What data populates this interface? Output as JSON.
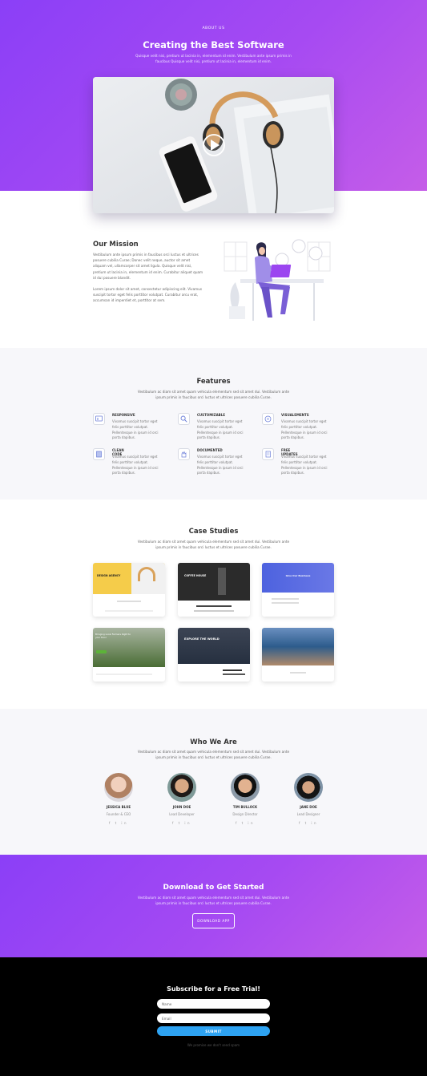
{
  "hero": {
    "breadcrumb": "ABOUT US",
    "title": "Creating the Best Software",
    "subtitle": "Quisque velit nisi, pretium ut lacinia in, elementum id enim. Vestibulum ante ipsum primis in faucibus Quisque velit nisi, pretium ut lacinia in, elementum id enim."
  },
  "mission": {
    "title": "Our Mission",
    "para1": "Vestibulum ante ipsum primis in faucibus orci luctus et ultrices posuere cubilia Curae; Donec velit neque, auctor sit amet aliquam vel, ullamcorper sit amet ligula. Quisque velit nisi, pretium ut lacinia in, elementum id enim. Curabitur aliquet quam id dui posuere blandit.",
    "para2": "Lorem ipsum dolor sit amet, consectetur adipiscing elit. Vivamus suscipit tortor eget felis porttitor volutpat. Curabitur arcu erat, accumsan id imperdiet et, porttitor at sem."
  },
  "features": {
    "title": "Features",
    "intro": "Vestibulum ac diam sit amet quam vehicula elementum sed sit amet dui. Vestibulum ante ipsum primis in faucibus orci luctus et ultrices posuere cubilia Curae.",
    "items": [
      {
        "title": "RESPONSIVE",
        "text": "Vivamus suscipit tortor eget felis porttitor volutpat. Pellentesque in ipsum id orci porta dapibus.",
        "icon": "responsive-icon"
      },
      {
        "title": "CUSTOMIZABLE",
        "text": "Vivamus suscipit tortor eget felis porttitor volutpat. Pellentesque in ipsum id orci porta dapibus.",
        "icon": "search-icon"
      },
      {
        "title": "VISUALEMENTS",
        "text": "Vivamus suscipit tortor eget felis porttitor volutpat. Pellentesque in ipsum id orci porta dapibus.",
        "icon": "layers-icon"
      },
      {
        "title": "CLEAN CODE",
        "text": "Vivamus suscipit tortor eget felis porttitor volutpat. Pellentesque in ipsum id orci porta dapibus.",
        "icon": "book-icon"
      },
      {
        "title": "DOCUMENTED",
        "text": "Vivamus suscipit tortor eget felis porttitor volutpat. Pellentesque in ipsum id orci porta dapibus.",
        "icon": "hand-icon"
      },
      {
        "title": "FREE UPDATES",
        "text": "Vivamus suscipit tortor eget felis porttitor volutpat. Pellentesque in ipsum id orci porta dapibus.",
        "icon": "document-icon"
      }
    ]
  },
  "case_studies": {
    "title": "Case Studies",
    "intro": "Vestibulum ac diam sit amet quam vehicula elementum sed sit amet dui. Vestibulum ante ipsum primis in faucibus orci luctus et ultrices posuere cubilia Curae.",
    "cards": [
      {
        "headline": "DESIGN AGENCY",
        "accent": "#f5cc4a"
      },
      {
        "headline": "COFFEE HOUSE",
        "accent": "#2b2b2b"
      },
      {
        "headline": "Give Our Business",
        "accent": "#5a6fe0"
      },
      {
        "headline": "Bringing Local Farmers Right to your Door",
        "accent": "#4a6d35"
      },
      {
        "headline": "EXPLORE THE WORLD",
        "accent": "#263040"
      },
      {
        "headline": "",
        "accent": "#2d5c8c"
      }
    ]
  },
  "team": {
    "title": "Who We Are",
    "intro": "Vestibulum ac diam sit amet quam vehicula elementum sed sit amet dui. Vestibulum ante ipsum primis in faucibus orci luctus et ultrices posuere cubilia Curae.",
    "members": [
      {
        "name": "JESSICA BLUE",
        "role": "Founder & CEO",
        "social": "f t in"
      },
      {
        "name": "JOHN DOE",
        "role": "Lead Developer",
        "social": "f t in"
      },
      {
        "name": "TIM BULLOCK",
        "role": "Design Director",
        "social": "f t in"
      },
      {
        "name": "JANE DOE",
        "role": "Lead Designer",
        "social": "f t in"
      }
    ]
  },
  "cta": {
    "title": "Download to Get Started",
    "text": "Vestibulum ac diam sit amet quam vehicula elementum sed sit amet dui. Vestibulum ante ipsum primis in faucibus orci luctus et ultrices posuere cubilia Curae.",
    "button": "DOWNLOAD APP"
  },
  "subscribe": {
    "title": "Subscribe for a Free Trial!",
    "name_placeholder": "Name",
    "email_placeholder": "Email",
    "submit": "SUBMIT",
    "note": "We promise we don't send spam"
  },
  "colors": {
    "gradient_start": "#8b3ff7",
    "gradient_end": "#c55de8",
    "accent_blue": "#2ea3f2"
  }
}
